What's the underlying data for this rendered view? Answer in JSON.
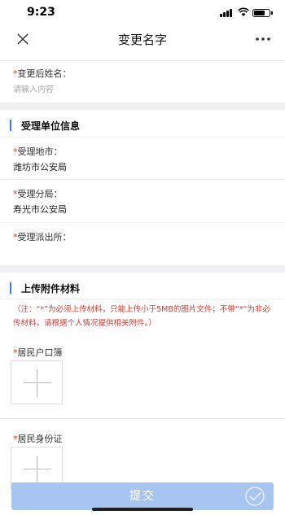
{
  "status_bar": {
    "time": "9:23"
  },
  "nav": {
    "title": "变更名字"
  },
  "new_name": {
    "label": "变更后姓名：",
    "placeholder": "请输入内容"
  },
  "section_unit": {
    "title": "受理单位信息"
  },
  "fields": {
    "city": {
      "label": "受理地市：",
      "value": "潍坊市公安局"
    },
    "branch": {
      "label": "受理分局：",
      "value": "寿光市公安局"
    },
    "station": {
      "label": "受理派出所："
    }
  },
  "section_attach": {
    "title": "上传附件材料",
    "note": "（注：“*”为必须上传材料，只能上传小于5MB的图片文件；不带“*”为非必传材料，请根据个人情况提供相关附件。）"
  },
  "attachments": [
    {
      "label": "居民户口簿"
    },
    {
      "label": "居民身份证"
    }
  ],
  "required_mark": "*",
  "submit_label": "提交",
  "colors": {
    "accent": "#3478f6",
    "required": "#d83a32",
    "submit_bg": "#a7c5f0"
  }
}
